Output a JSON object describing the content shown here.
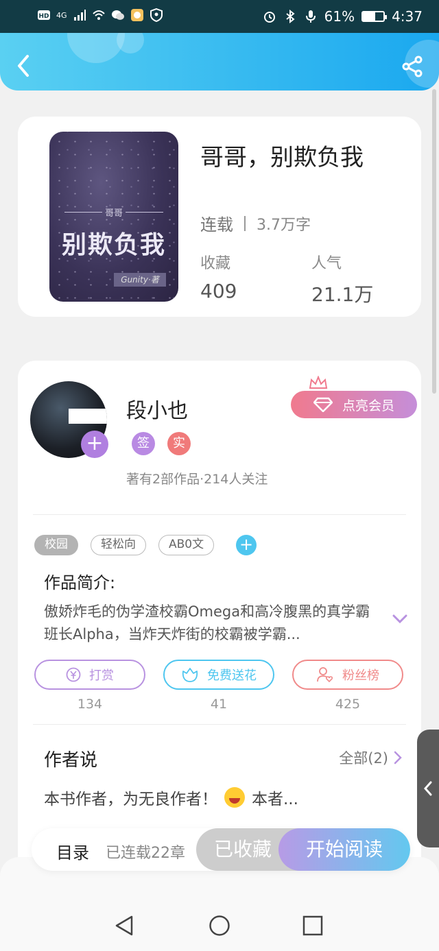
{
  "status_bar": {
    "network": "4G",
    "battery": "61%",
    "battery_level": 0.61,
    "time": "4:37"
  },
  "header": {
    "back_icon": "chevron-left-icon",
    "share_icon": "share-icon"
  },
  "book": {
    "cover": {
      "subtitle": "哥哥",
      "title": "别欺负我",
      "author": "Gunity·著"
    },
    "title": "哥哥，别欺负我",
    "status": "连载",
    "word_count": "3.7万字",
    "stats": [
      {
        "label": "收藏",
        "value": "409"
      },
      {
        "label": "人气",
        "value": "21.1万"
      }
    ]
  },
  "author": {
    "name": "段小也",
    "badges": [
      "签",
      "实"
    ],
    "meta": "著有2部作品·214人关注",
    "vip_button": "点亮会员",
    "avatar_add": "+"
  },
  "tags": [
    "校园",
    "轻松向",
    "AB0文"
  ],
  "tag_add": "+",
  "intro": {
    "label": "作品简介:",
    "text": "傲娇炸毛的伪学渣校霸Omega和高冷腹黑的真学霸班长Alpha，当炸天炸街的校霸被学霸..."
  },
  "actions": [
    {
      "label": "打赏",
      "count": "134",
      "color": "#b892e0",
      "icon": "yuan-coin-icon"
    },
    {
      "label": "免费送花",
      "count": "41",
      "color": "#4ec6ef",
      "icon": "flower-icon"
    },
    {
      "label": "粉丝榜",
      "count": "425",
      "color": "#f08a8a",
      "icon": "fan-user-icon"
    }
  ],
  "author_says": {
    "label": "作者说",
    "all": "全部(2)",
    "text_before": "本书作者，为无良作者！",
    "text_after": "本者..."
  },
  "bottom_bar": {
    "toc": "目录",
    "chapters": "已连载22章",
    "collected": "已收藏",
    "start_reading": "开始阅读"
  },
  "colors": {
    "header_start": "#5ad0f2",
    "header_end": "#1aa8ef",
    "accent_purple": "#b07fe0",
    "badge_sign": "#b98ae3",
    "badge_real": "#f07a7a"
  }
}
